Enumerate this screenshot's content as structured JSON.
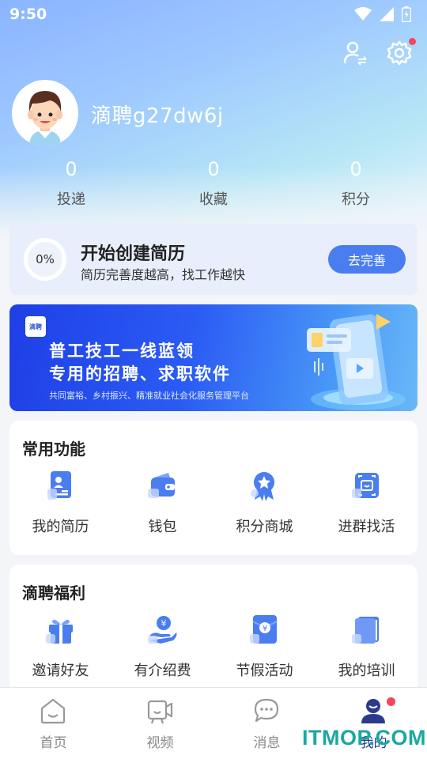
{
  "status_bar": {
    "time": "9:50"
  },
  "profile": {
    "username": "滴聘g27dw6j"
  },
  "stats": [
    {
      "value": "0",
      "label": "投递"
    },
    {
      "value": "0",
      "label": "收藏"
    },
    {
      "value": "0",
      "label": "积分"
    }
  ],
  "resume": {
    "progress": "0%",
    "title": "开始创建简历",
    "subtitle": "简历完善度越高，找工作越快",
    "button": "去完善"
  },
  "banner": {
    "logo": "滴聘",
    "title_line1": "普工技工一线蓝领",
    "title_line2": "专用的招聘、求职软件",
    "subtitle": "共同富裕、乡村振兴、精准就业社会化服务管理平台"
  },
  "common_functions": {
    "title": "常用功能",
    "items": [
      {
        "label": "我的简历",
        "icon": "resume-icon"
      },
      {
        "label": "钱包",
        "icon": "wallet-icon"
      },
      {
        "label": "积分商城",
        "icon": "points-mall-icon"
      },
      {
        "label": "进群找活",
        "icon": "join-group-icon"
      }
    ]
  },
  "welfare": {
    "title": "滴聘福利",
    "items": [
      {
        "label": "邀请好友",
        "icon": "gift-icon"
      },
      {
        "label": "有介绍费",
        "icon": "referral-fee-icon"
      },
      {
        "label": "节假活动",
        "icon": "red-envelope-icon"
      },
      {
        "label": "我的培训",
        "icon": "book-icon"
      }
    ]
  },
  "bottom_nav": [
    {
      "label": "首页",
      "icon": "home-icon"
    },
    {
      "label": "视频",
      "icon": "video-icon"
    },
    {
      "label": "消息",
      "icon": "message-icon"
    },
    {
      "label": "我的",
      "icon": "profile-icon",
      "active": true
    }
  ],
  "watermark": "ITMOP.COM",
  "colors": {
    "accent": "#4a7df0",
    "nav_active": "#2b3a8c",
    "badge": "#f5455c"
  }
}
